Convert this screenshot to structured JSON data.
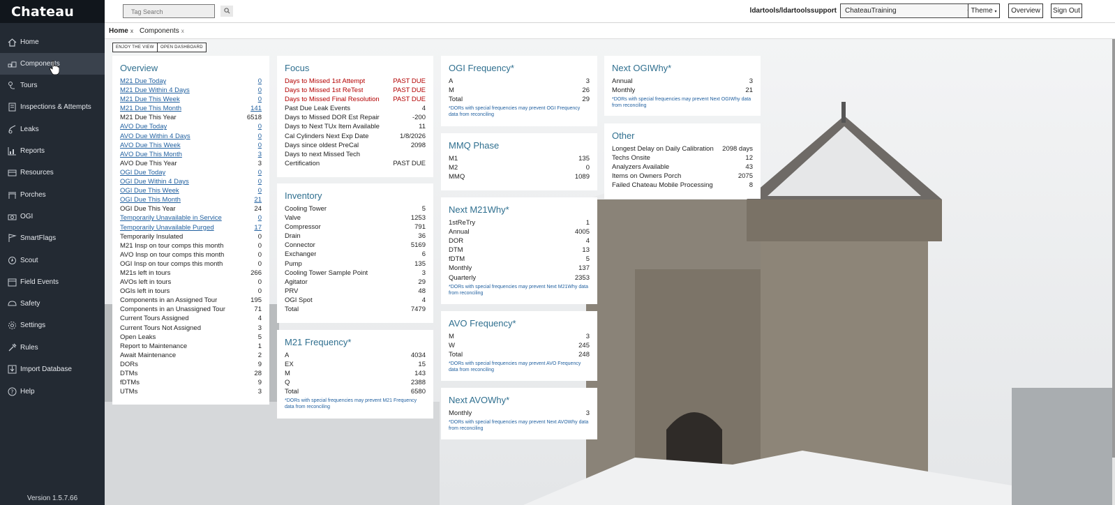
{
  "app": {
    "brand": "Chateau",
    "version": "Version 1.5.7.66"
  },
  "sidebar": {
    "items": [
      {
        "label": "Home",
        "icon": "home-icon"
      },
      {
        "label": "Components",
        "icon": "components-icon"
      },
      {
        "label": "Tours",
        "icon": "tours-icon"
      },
      {
        "label": "Inspections & Attempts",
        "icon": "inspections-icon"
      },
      {
        "label": "Leaks",
        "icon": "leaks-icon"
      },
      {
        "label": "Reports",
        "icon": "reports-icon"
      },
      {
        "label": "Resources",
        "icon": "resources-icon"
      },
      {
        "label": "Porches",
        "icon": "porches-icon"
      },
      {
        "label": "OGI",
        "icon": "camera-icon"
      },
      {
        "label": "SmartFlags",
        "icon": "flag-icon"
      },
      {
        "label": "Scout",
        "icon": "scout-icon"
      },
      {
        "label": "Field Events",
        "icon": "calendar-icon"
      },
      {
        "label": "Safety",
        "icon": "safety-icon"
      },
      {
        "label": "Settings",
        "icon": "gear-icon"
      },
      {
        "label": "Rules",
        "icon": "rules-icon"
      },
      {
        "label": "Import Database",
        "icon": "database-icon"
      },
      {
        "label": "Help",
        "icon": "help-icon"
      }
    ]
  },
  "topbar": {
    "search_placeholder": "Tag Search",
    "user": "ldartools/ldartoolssupport",
    "site": "ChateauTraining",
    "theme_label": "Theme",
    "overview_label": "Overview",
    "signout_label": "Sign Out"
  },
  "tabs": [
    {
      "label": "Home"
    },
    {
      "label": "Components"
    }
  ],
  "buttons": {
    "enjoy": "ENJOY THE VIEW",
    "dashboard": "OPEN DASHBOARD"
  },
  "overview": {
    "title": "Overview",
    "rows": [
      {
        "label": "M21 Due Today",
        "value": "0",
        "link": true
      },
      {
        "label": "M21 Due Within 4 Days",
        "value": "0",
        "link": true
      },
      {
        "label": "M21 Due This Week",
        "value": "0",
        "link": true
      },
      {
        "label": "M21 Due This Month",
        "value": "141",
        "link": true
      },
      {
        "label": "M21 Due This Year",
        "value": "6518",
        "link": false
      },
      {
        "label": "AVO Due Today",
        "value": "0",
        "link": true
      },
      {
        "label": "AVO Due Within 4 Days",
        "value": "0",
        "link": true
      },
      {
        "label": "AVO Due This Week",
        "value": "0",
        "link": true
      },
      {
        "label": "AVO Due This Month",
        "value": "3",
        "link": true
      },
      {
        "label": "AVO Due This Year",
        "value": "3",
        "link": false
      },
      {
        "label": "OGI Due Today",
        "value": "0",
        "link": true
      },
      {
        "label": "OGI Due Within 4 Days",
        "value": "0",
        "link": true
      },
      {
        "label": "OGI Due This Week",
        "value": "0",
        "link": true
      },
      {
        "label": "OGI Due This Month",
        "value": "21",
        "link": true
      },
      {
        "label": "OGI Due This Year",
        "value": "24",
        "link": false
      },
      {
        "label": "Temporarily Unavailable in Service",
        "value": "0",
        "link": true
      },
      {
        "label": "Temporarily Unavailable Purged",
        "value": "17",
        "link": true
      },
      {
        "label": "Temporarily Insulated",
        "value": "0",
        "link": false
      },
      {
        "label": "M21 Insp on tour comps this month",
        "value": "0",
        "link": false
      },
      {
        "label": "AVO Insp on tour comps this month",
        "value": "0",
        "link": false
      },
      {
        "label": "OGI Insp on tour comps this month",
        "value": "0",
        "link": false
      },
      {
        "label": "M21s left in tours",
        "value": "266",
        "link": false
      },
      {
        "label": "AVOs left in tours",
        "value": "0",
        "link": false
      },
      {
        "label": "OGIs left in tours",
        "value": "0",
        "link": false
      },
      {
        "label": "Components in an Assigned Tour",
        "value": "195",
        "link": false
      },
      {
        "label": "Components in an Unassigned Tour",
        "value": "71",
        "link": false
      },
      {
        "label": "Current Tours Assigned",
        "value": "4",
        "link": false
      },
      {
        "label": "Current Tours Not Assigned",
        "value": "3",
        "link": false
      },
      {
        "label": "Open Leaks",
        "value": "5",
        "link": false
      },
      {
        "label": "Report to Maintenance",
        "value": "1",
        "link": false
      },
      {
        "label": "Await Maintenance",
        "value": "2",
        "link": false
      },
      {
        "label": "DORs",
        "value": "9",
        "link": false
      },
      {
        "label": "DTMs",
        "value": "28",
        "link": false
      },
      {
        "label": "fDTMs",
        "value": "9",
        "link": false
      },
      {
        "label": "UTMs",
        "value": "3",
        "link": false
      }
    ]
  },
  "focus": {
    "title": "Focus",
    "rows": [
      {
        "label": "Days to Missed 1st Attempt",
        "value": "PAST DUE",
        "red": true
      },
      {
        "label": "Days to Missed 1st ReTest",
        "value": "PAST DUE",
        "red": true
      },
      {
        "label": "Days to Missed Final Resolution",
        "value": "PAST DUE",
        "red": true
      },
      {
        "label": "Past Due Leak Events",
        "value": "4",
        "red": false
      },
      {
        "label": "Days to Missed DOR Est Repair",
        "value": "-200",
        "red": false
      },
      {
        "label": "Days to Next TUx Item Available",
        "value": "11",
        "red": false
      },
      {
        "label": "Cal Cylinders Next Exp Date",
        "value": "1/8/2026",
        "red": false
      },
      {
        "label": "Days since oldest PreCal",
        "value": "2098",
        "red": false
      },
      {
        "label": "Days to next Missed Tech",
        "value": "",
        "red": false
      },
      {
        "label": "Certification",
        "value": "PAST DUE",
        "red": false
      }
    ]
  },
  "inventory": {
    "title": "Inventory",
    "rows": [
      {
        "label": "Cooling Tower",
        "value": "5"
      },
      {
        "label": "Valve",
        "value": "1253"
      },
      {
        "label": "Compressor",
        "value": "791"
      },
      {
        "label": "Drain",
        "value": "36"
      },
      {
        "label": "Connector",
        "value": "5169"
      },
      {
        "label": "Exchanger",
        "value": "6"
      },
      {
        "label": "Pump",
        "value": "135"
      },
      {
        "label": "Cooling Tower Sample Point",
        "value": "3"
      },
      {
        "label": "Agitator",
        "value": "29"
      },
      {
        "label": "PRV",
        "value": "48"
      },
      {
        "label": "OGI Spot",
        "value": "4"
      },
      {
        "label": "Total",
        "value": "7479"
      }
    ]
  },
  "m21_frequency": {
    "title": "M21 Frequency*",
    "rows": [
      {
        "label": "A",
        "value": "4034"
      },
      {
        "label": "EX",
        "value": "15"
      },
      {
        "label": "M",
        "value": "143"
      },
      {
        "label": "Q",
        "value": "2388"
      },
      {
        "label": "Total",
        "value": "6580"
      }
    ],
    "note": "*DORs with special frequencies may prevent M21 Frequency data from reconciling"
  },
  "ogi_frequency": {
    "title": "OGI Frequency*",
    "rows": [
      {
        "label": "A",
        "value": "3"
      },
      {
        "label": "M",
        "value": "26"
      },
      {
        "label": "Total",
        "value": "29"
      }
    ],
    "note": "*DORs with special frequencies may prevent OGI Frequency data from reconciling"
  },
  "mmq_phase": {
    "title": "MMQ Phase",
    "rows": [
      {
        "label": "M1",
        "value": "135"
      },
      {
        "label": "M2",
        "value": "0"
      },
      {
        "label": "MMQ",
        "value": "1089"
      }
    ]
  },
  "next_m21why": {
    "title": "Next M21Why*",
    "rows": [
      {
        "label": "1stReTry",
        "value": "1"
      },
      {
        "label": "Annual",
        "value": "4005"
      },
      {
        "label": "DOR",
        "value": "4"
      },
      {
        "label": "DTM",
        "value": "13"
      },
      {
        "label": "fDTM",
        "value": "5"
      },
      {
        "label": "Monthly",
        "value": "137"
      },
      {
        "label": "Quarterly",
        "value": "2353"
      }
    ],
    "note": "*DORs with special frequencies may prevent Next M21Why data from reconciling"
  },
  "avo_frequency": {
    "title": "AVO Frequency*",
    "rows": [
      {
        "label": "M",
        "value": "3"
      },
      {
        "label": "W",
        "value": "245"
      },
      {
        "label": "Total",
        "value": "248"
      }
    ],
    "note": "*DORs with special frequencies may prevent AVO Frequency data from reconciling"
  },
  "next_avowhy": {
    "title": "Next AVOWhy*",
    "rows": [
      {
        "label": "Monthly",
        "value": "3"
      }
    ],
    "note": "*DORs with special frequencies may prevent Next AVOWhy data from reconciling"
  },
  "next_ogiwhy": {
    "title": "Next OGIWhy*",
    "rows": [
      {
        "label": "Annual",
        "value": "3"
      },
      {
        "label": "Monthly",
        "value": "21"
      }
    ],
    "note": "*DORs with special frequencies may prevent Next OGIWhy data from reconciling"
  },
  "other": {
    "title": "Other",
    "rows": [
      {
        "label": "Longest Delay on Daily Calibration",
        "value": "2098 days"
      },
      {
        "label": "Techs Onsite",
        "value": "12"
      },
      {
        "label": "Analyzers Available",
        "value": "43"
      },
      {
        "label": "Items on Owners Porch",
        "value": "2075"
      },
      {
        "label": "Failed Chateau Mobile Processing",
        "value": "8"
      }
    ]
  }
}
